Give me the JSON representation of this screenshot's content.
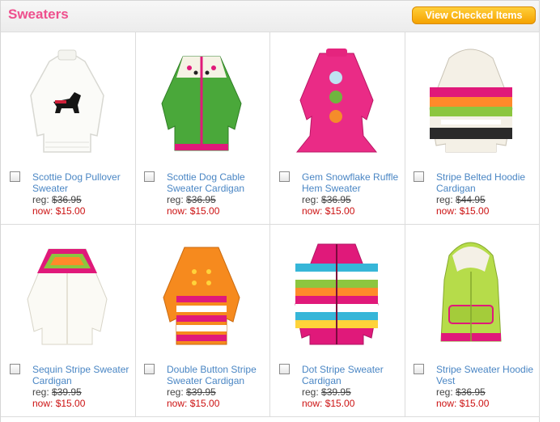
{
  "header": {
    "title": "Sweaters",
    "view_button_label": "View Checked Items"
  },
  "products": [
    {
      "name": "Scottie Dog Pullover Sweater",
      "reg_label": "reg:",
      "reg_price": "$36.95",
      "now_label": "now:",
      "now_price": "$15.00",
      "image": "white-pullover-scottie-dog"
    },
    {
      "name": "Scottie Dog Cable Sweater Cardigan",
      "reg_label": "reg:",
      "reg_price": "$36.95",
      "now_label": "now:",
      "now_price": "$15.00",
      "image": "green-cable-cardigan"
    },
    {
      "name": "Gem Snowflake Ruffle Hem Sweater",
      "reg_label": "reg:",
      "reg_price": "$36.95",
      "now_label": "now:",
      "now_price": "$15.00",
      "image": "pink-snowflake-sweater"
    },
    {
      "name": "Stripe Belted Hoodie Cardigan",
      "reg_label": "reg:",
      "reg_price": "$44.95",
      "now_label": "now:",
      "now_price": "$15.00",
      "image": "striped-belted-hoodie"
    },
    {
      "name": "Sequin Stripe Sweater Cardigan",
      "reg_label": "reg:",
      "reg_price": "$39.95",
      "now_label": "now:",
      "now_price": "$15.00",
      "image": "white-sequin-cardigan"
    },
    {
      "name": "Double Button Stripe Sweater Cardigan",
      "reg_label": "reg:",
      "reg_price": "$39.95",
      "now_label": "now:",
      "now_price": "$15.00",
      "image": "orange-double-button-cardigan"
    },
    {
      "name": "Dot Stripe Sweater Cardigan",
      "reg_label": "reg:",
      "reg_price": "$39.95",
      "now_label": "now:",
      "now_price": "$15.00",
      "image": "multicolor-dot-stripe-cardigan"
    },
    {
      "name": "Stripe Sweater Hoodie Vest",
      "reg_label": "reg:",
      "reg_price": "$36.95",
      "now_label": "now:",
      "now_price": "$15.00",
      "image": "lime-hoodie-vest"
    }
  ]
}
